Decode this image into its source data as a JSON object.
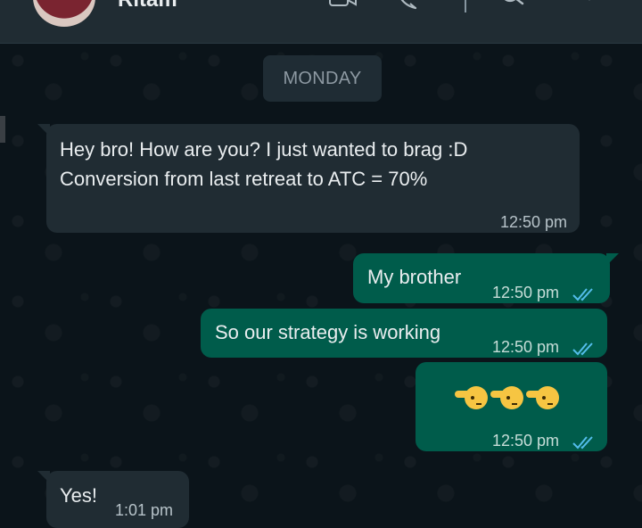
{
  "header": {
    "contact_name": "Ritam",
    "icons": [
      "video-call-icon",
      "voice-call-icon",
      "search-icon",
      "menu-chevron-icon"
    ]
  },
  "chat": {
    "day_label": "MONDAY",
    "messages": [
      {
        "direction": "incoming",
        "lines": [
          "Hey bro! How are you? I just wanted to brag :D",
          "Conversion from last retreat to ATC = 70%"
        ],
        "time": "12:50 pm"
      },
      {
        "direction": "outgoing",
        "text": "My brother",
        "time": "12:50 pm",
        "status": "read"
      },
      {
        "direction": "outgoing",
        "text": "So our strategy is working",
        "time": "12:50 pm",
        "status": "read"
      },
      {
        "direction": "outgoing",
        "emoji": [
          "🫡",
          "🫡",
          "🫡"
        ],
        "emoji_name": "pointing-hands-emoji",
        "time": "12:50 pm",
        "status": "read"
      },
      {
        "direction": "incoming",
        "text": "Yes!",
        "time": "1:01 pm"
      }
    ]
  },
  "colors": {
    "background": "#0b141a",
    "incoming_bubble": "#202c33",
    "outgoing_bubble": "#005c4b",
    "read_ticks": "#53bdeb"
  }
}
